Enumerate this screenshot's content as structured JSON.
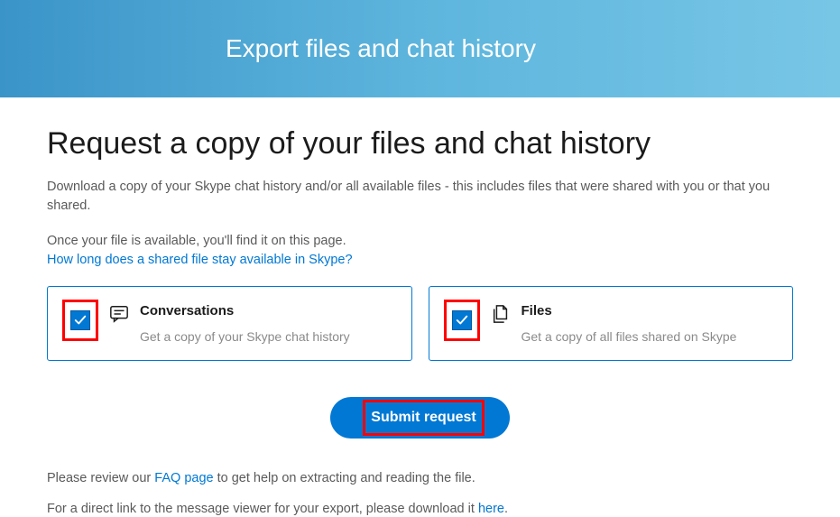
{
  "banner": {
    "title": "Export files and chat history"
  },
  "heading": "Request a copy of your files and chat history",
  "intro_para": "Download a copy of your Skype chat history and/or all available files - this includes files that were shared with you or that you shared.",
  "availability_line": "Once your file is available, you'll find it on this page.",
  "retention_link": "How long does a shared file stay available in Skype?",
  "options": {
    "conversations": {
      "title": "Conversations",
      "description": "Get a copy of your Skype chat history"
    },
    "files": {
      "title": "Files",
      "description": "Get a copy of all files shared on Skype"
    }
  },
  "submit_label": "Submit request",
  "footer_faq_prefix": "Please review our ",
  "footer_faq_link": "FAQ page",
  "footer_faq_suffix": " to get help on extracting and reading the file.",
  "footer_viewer_prefix": "For a direct link to the message viewer for your export, please download it ",
  "footer_viewer_link": "here",
  "footer_viewer_suffix": "."
}
